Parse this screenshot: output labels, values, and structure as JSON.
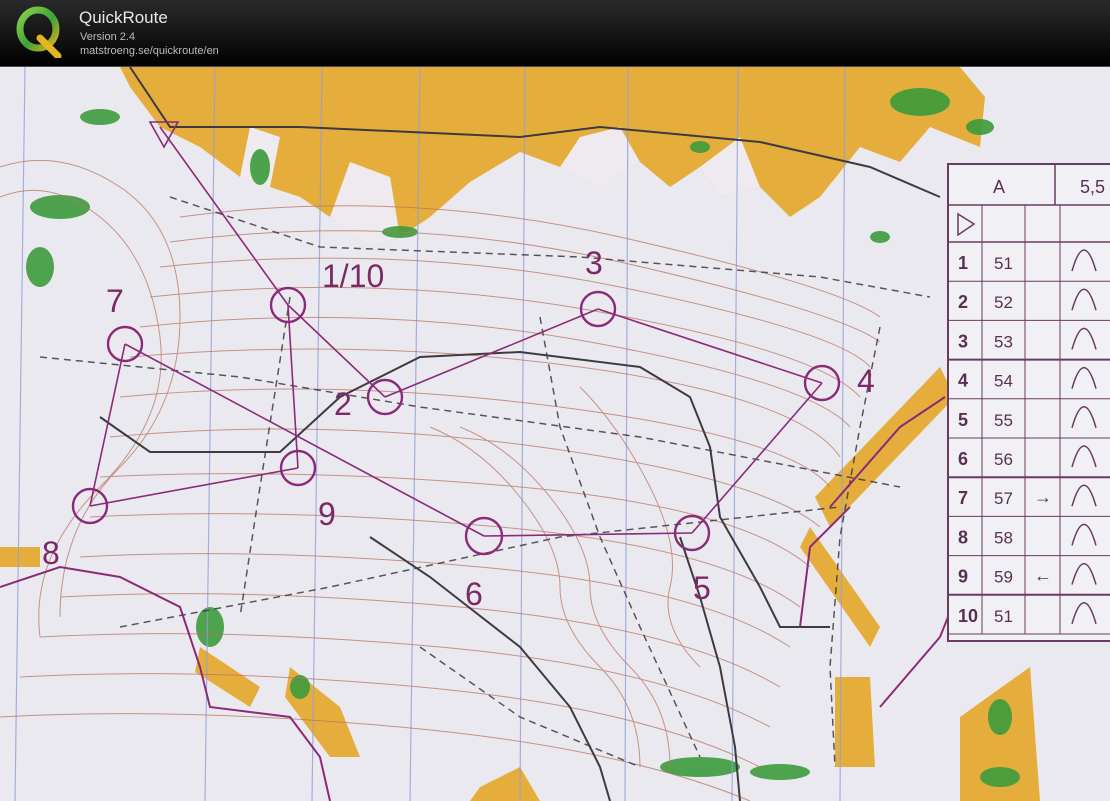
{
  "app": {
    "title": "QuickRoute",
    "version": "Version 2.4",
    "url": "matstroeng.se/quickroute/en",
    "logo_letter": "Q"
  },
  "colors": {
    "header_bg": "#000000",
    "course_purple": "#8a2a78",
    "open_land": "#e8b13a",
    "vegetation_green": "#3a9a3a",
    "contour_brown": "#b06a52",
    "paper": "#e9e8ef"
  },
  "map": {
    "controls": [
      {
        "label": "1/10"
      },
      {
        "label": "2"
      },
      {
        "label": "3"
      },
      {
        "label": "4"
      },
      {
        "label": "5"
      },
      {
        "label": "6"
      },
      {
        "label": "7"
      },
      {
        "label": "8"
      },
      {
        "label": "9"
      }
    ]
  },
  "description_sheet": {
    "header_course": "A",
    "header_length": "5,5",
    "rows": [
      {
        "num": "1",
        "code": "51",
        "dir": ""
      },
      {
        "num": "2",
        "code": "52",
        "dir": ""
      },
      {
        "num": "3",
        "code": "53",
        "dir": ""
      },
      {
        "num": "4",
        "code": "54",
        "dir": ""
      },
      {
        "num": "5",
        "code": "55",
        "dir": ""
      },
      {
        "num": "6",
        "code": "56",
        "dir": ""
      },
      {
        "num": "7",
        "code": "57",
        "dir": "→"
      },
      {
        "num": "8",
        "code": "58",
        "dir": ""
      },
      {
        "num": "9",
        "code": "59",
        "dir": "←"
      },
      {
        "num": "10",
        "code": "51",
        "dir": ""
      }
    ]
  }
}
